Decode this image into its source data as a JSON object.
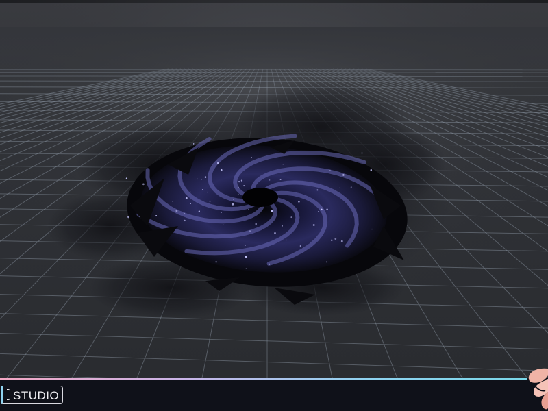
{
  "footer": {
    "studio_label": "STUDIO"
  },
  "colors": {
    "footer_background": "#0f1119",
    "footer_line_start": "#f2a7c3",
    "footer_line_end": "#7ad7e8",
    "grid_line": "#8f99a6",
    "vortex_core": "#2a2a5e",
    "logo": "#f0b3a6"
  },
  "icons": {
    "logo": "brand-logo-icon"
  }
}
